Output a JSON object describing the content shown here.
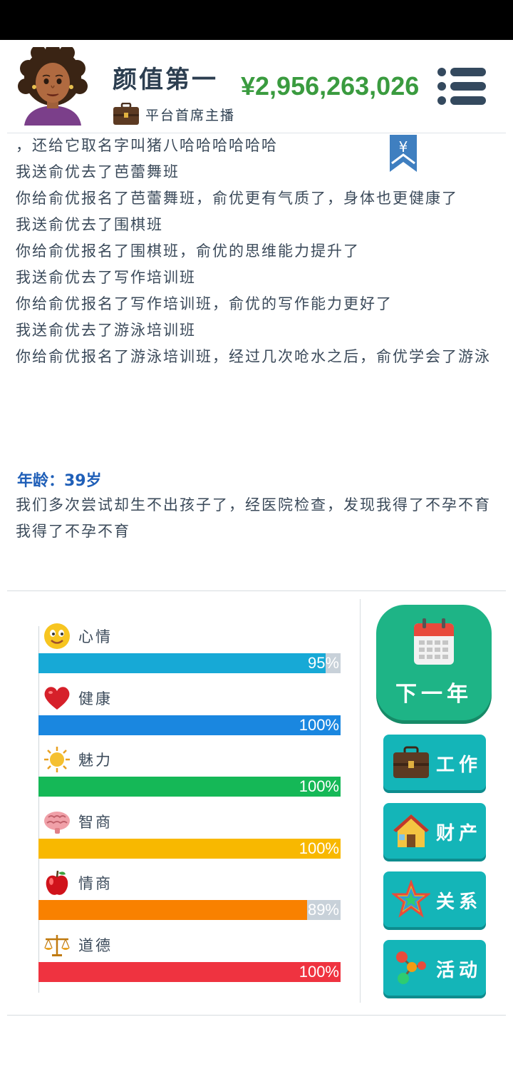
{
  "header": {
    "player_name": "颜值第一",
    "money": "¥2,956,263,026",
    "job_title": "平台首席主播"
  },
  "log_top": [
    "，还给它取名字叫猪八哈哈哈哈哈哈",
    "我送俞优去了芭蕾舞班",
    "你给俞优报名了芭蕾舞班，俞优更有气质了，身体也更健康了",
    "我送俞优去了围棋班",
    "你给俞优报名了围棋班，俞优的思维能力提升了",
    "我送俞优去了写作培训班",
    "你给俞优报名了写作培训班，俞优的写作能力更好了",
    "我送俞优去了游泳培训班",
    "你给俞优报名了游泳培训班，经过几次呛水之后，俞优学会了游泳"
  ],
  "bookmark_symbol": "¥",
  "age_label": "年龄：39岁",
  "log_bottom": [
    "我们多次尝试却生不出孩子了，经医院检查，发现我得了不孕不育",
    "我得了不孕不育"
  ],
  "stats": [
    {
      "label": "心情",
      "icon": "smiley-icon",
      "percent": 95,
      "value_text": "95%",
      "color": "#17a9d6"
    },
    {
      "label": "健康",
      "icon": "heart-icon",
      "percent": 100,
      "value_text": "100%",
      "color": "#1a87e0"
    },
    {
      "label": "魅力",
      "icon": "sun-icon",
      "percent": 100,
      "value_text": "100%",
      "color": "#15b857"
    },
    {
      "label": "智商",
      "icon": "brain-icon",
      "percent": 100,
      "value_text": "100%",
      "color": "#f8b800"
    },
    {
      "label": "情商",
      "icon": "apple-icon",
      "percent": 89,
      "value_text": "89%",
      "color": "#f98100"
    },
    {
      "label": "道德",
      "icon": "scales-icon",
      "percent": 100,
      "value_text": "100%",
      "color": "#ef3340"
    }
  ],
  "buttons": {
    "next_year": "下一年",
    "work": "工作",
    "assets": "财产",
    "relations": "关系",
    "activities": "活动"
  }
}
